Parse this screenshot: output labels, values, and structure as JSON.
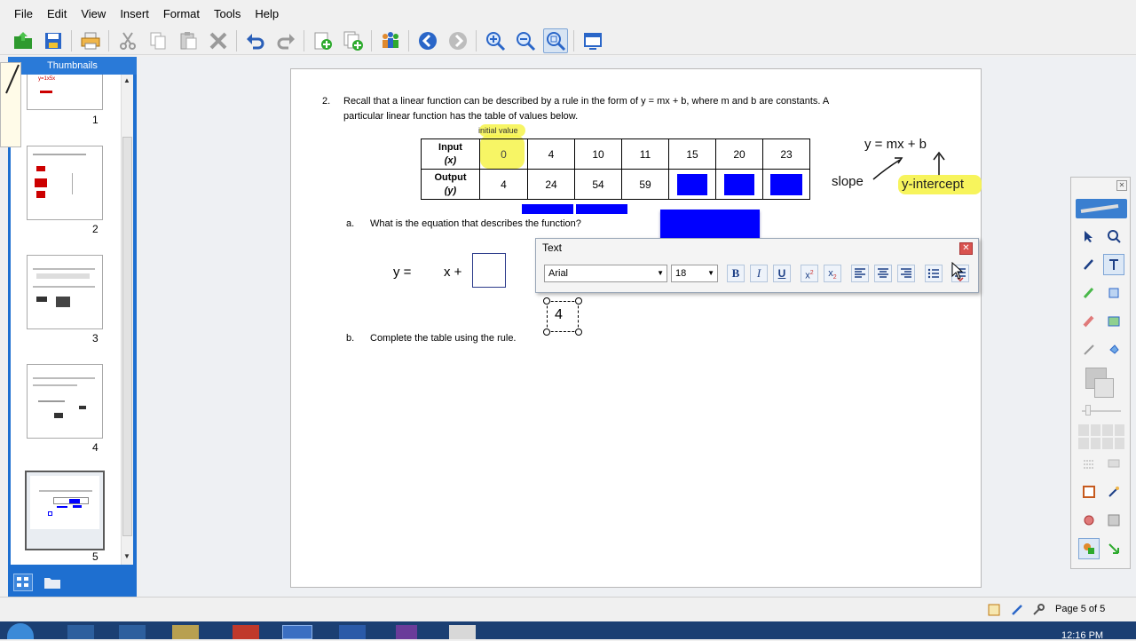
{
  "menu": [
    "File",
    "Edit",
    "View",
    "Insert",
    "Format",
    "Tools",
    "Help"
  ],
  "toolbar": {
    "icons": [
      "open-icon",
      "save-icon",
      "print-icon",
      "cut-icon",
      "copy-icon",
      "paste-icon",
      "delete-icon",
      "undo-icon",
      "redo-icon",
      "new-page-icon",
      "duplicate-page-icon",
      "share-icon",
      "back-icon",
      "forward-icon",
      "zoom-in-icon",
      "zoom-out-icon",
      "zoom-fit-icon",
      "screen-icon"
    ]
  },
  "thumbnails": {
    "title": "Thumbnails",
    "pages": [
      "1",
      "2",
      "3",
      "4",
      "5"
    ],
    "page1_snippet": "y=1x5x"
  },
  "worksheet": {
    "question_number": "2.",
    "question_line1": "Recall that a linear function can be described by a rule in the form of y = mx + b, where m and b are constants.  A",
    "question_line2": "particular linear function has the table of values below.",
    "initial_value_note": "initial value",
    "input_label": "Input",
    "input_var": "(x)",
    "output_label": "Output",
    "output_var": "(y)",
    "inputs": [
      "0",
      "4",
      "10",
      "11",
      "15",
      "20",
      "23"
    ],
    "outputs": [
      "4",
      "24",
      "54",
      "59",
      "",
      "",
      ""
    ],
    "annotation_formula": "y = mx + b",
    "annotation_slope": "slope",
    "annotation_intercept": "y-intercept",
    "part_a_label": "a.",
    "part_a_text": "What is the equation that describes the function?",
    "eq_y": "y =",
    "eq_x": "x +",
    "moved_value": "4",
    "part_b_label": "b.",
    "part_b_text": "Complete the table using the rule."
  },
  "text_dialog": {
    "title": "Text",
    "font": "Arial",
    "size": "18"
  },
  "status": {
    "page_indicator": "Page 5 of 5"
  },
  "taskbar": {
    "clock": "12:16 PM"
  },
  "colors": {
    "highlight": "#f6f34a",
    "blue_box": "#0000ff",
    "panel_blue": "#1e6fd0"
  }
}
